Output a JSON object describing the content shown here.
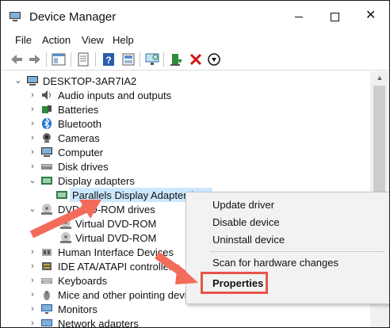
{
  "window": {
    "title": "Device Manager",
    "controls": {
      "minimize": "—",
      "maximize": "",
      "close": "✕"
    }
  },
  "menu": [
    "File",
    "Action",
    "View",
    "Help"
  ],
  "toolbar": {
    "icons": [
      "back-icon",
      "forward-icon",
      "show-hide-console-tree-icon",
      "properties-icon",
      "help-icon",
      "view-icon",
      "monitor-scan-icon",
      "update-driver-icon",
      "uninstall-icon",
      "disable-icon"
    ]
  },
  "tree": {
    "root": "DESKTOP-3AR7IA2",
    "items": [
      {
        "label": "Audio inputs and outputs",
        "icon": "speaker-icon"
      },
      {
        "label": "Batteries",
        "icon": "battery-icon"
      },
      {
        "label": "Bluetooth",
        "icon": "bluetooth-icon"
      },
      {
        "label": "Cameras",
        "icon": "camera-icon"
      },
      {
        "label": "Computer",
        "icon": "computer-icon"
      },
      {
        "label": "Disk drives",
        "icon": "disk-drive-icon"
      },
      {
        "label": "Display adapters",
        "icon": "display-adapter-icon"
      },
      {
        "label": "Parallels Display Adapter (W",
        "icon": "display-adapter-icon"
      },
      {
        "label": "DVD/CD-ROM drives",
        "icon": "dvd-drive-icon"
      },
      {
        "label": "Virtual DVD-ROM",
        "icon": "dvd-drive-icon"
      },
      {
        "label": "Virtual DVD-ROM",
        "icon": "dvd-drive-icon"
      },
      {
        "label": "Human Interface Devices",
        "icon": "hid-icon"
      },
      {
        "label": "IDE ATA/ATAPI controllers",
        "icon": "ide-controller-icon"
      },
      {
        "label": "Keyboards",
        "icon": "keyboard-icon"
      },
      {
        "label": "Mice and other pointing devices",
        "icon": "mouse-icon"
      },
      {
        "label": "Monitors",
        "icon": "monitor-icon"
      },
      {
        "label": "Network adapters",
        "icon": "network-adapter-icon"
      }
    ]
  },
  "context_menu": {
    "items": [
      "Update driver",
      "Disable device",
      "Uninstall device",
      "Scan for hardware changes",
      "Properties"
    ]
  },
  "colors": {
    "selection": "#cce8ff",
    "highlight_border": "#e8534a",
    "arrow": "#f26b5b"
  }
}
